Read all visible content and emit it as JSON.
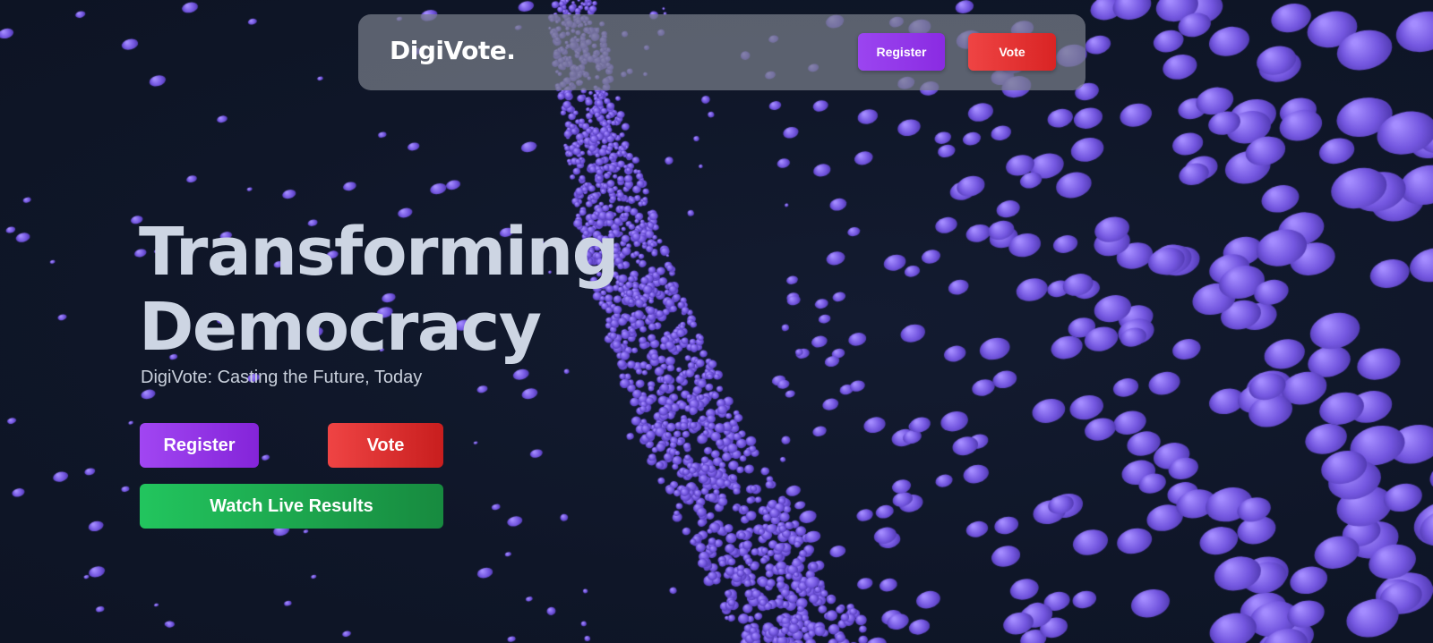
{
  "navbar": {
    "brand": "DigiVote.",
    "register_label": "Register",
    "vote_label": "Vote"
  },
  "hero": {
    "title_line1": "Transforming",
    "title_line2": "Democracy",
    "subtitle": "DigiVote: Casting the Future, Today",
    "register_label": "Register",
    "vote_label": "Vote",
    "watch_label": "Watch Live Results"
  },
  "colors": {
    "background": "#101729",
    "particle": "#7b5ce6",
    "register": "#9333ea",
    "vote": "#ef4444",
    "watch": "#22c55e"
  }
}
